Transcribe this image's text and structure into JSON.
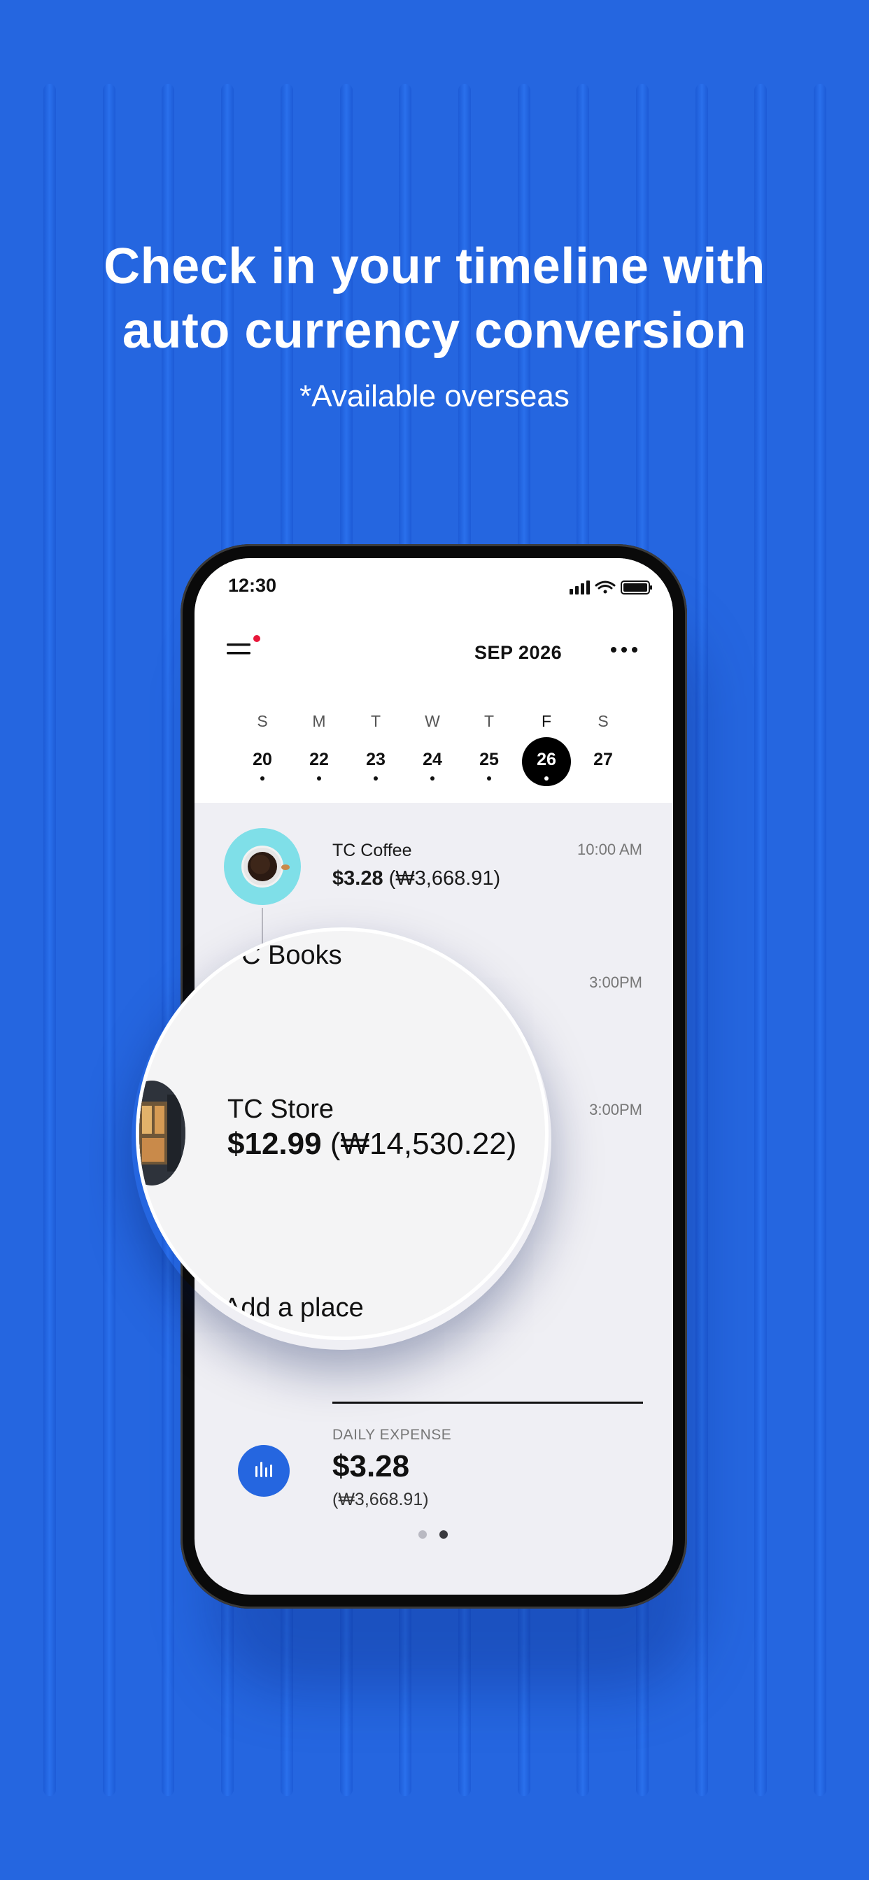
{
  "headline": {
    "line1": "Check in your timeline with",
    "line2": "auto currency conversion",
    "subtitle": "*Available overseas"
  },
  "colors": {
    "background": "#2566e0",
    "accent": "#2566e0",
    "notification_dot": "#e8173a",
    "selected_day": "#000000"
  },
  "status_bar": {
    "time": "12:30",
    "icons": [
      "cellular-signal-icon",
      "wifi-icon",
      "battery-icon"
    ]
  },
  "header": {
    "month": "SEP 2026",
    "menu_icon": "hamburger-menu-icon",
    "more_icon": "more-dots-icon"
  },
  "week": {
    "letters": [
      "S",
      "M",
      "T",
      "W",
      "T",
      "F",
      "S"
    ],
    "days": [
      "20",
      "22",
      "23",
      "24",
      "25",
      "26",
      "27"
    ],
    "selected_index": 5
  },
  "timeline": {
    "entries": [
      {
        "name": "TC Coffee",
        "price": "$3.28",
        "converted": "(₩3,668.91)",
        "time": "10:00 AM"
      },
      {
        "name": "Books",
        "partial_prefix": "C",
        "time": "3:00PM"
      },
      {
        "name": "TC Store",
        "price": "$12.99",
        "converted": "(₩14,530.22)",
        "time": "3:00PM"
      }
    ],
    "add_place": "Add a place",
    "add_place_visible": "Add a place"
  },
  "summary": {
    "label": "DAILY EXPENSE",
    "amount": "$3.28",
    "converted": "(₩3,668.91)",
    "icon": "bar-chart-icon",
    "pages": 2,
    "active_page": 2
  }
}
